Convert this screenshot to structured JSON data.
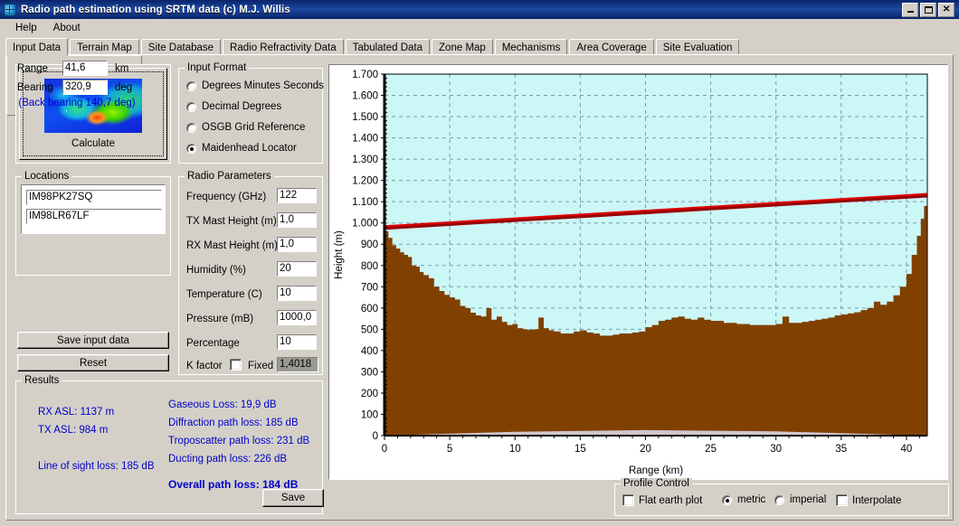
{
  "window": {
    "title": "Radio path estimation using SRTM data (c) M.J. Willis",
    "icon": "globe-icon",
    "minimize": "_",
    "maximize": "□",
    "close": "✕"
  },
  "menu": {
    "items": [
      "Help",
      "About"
    ]
  },
  "tabs": [
    {
      "label": "Input Data",
      "active": true
    },
    {
      "label": "Terrain Map",
      "active": false
    },
    {
      "label": "Site Database",
      "active": false
    },
    {
      "label": "Radio Refractivity Data",
      "active": false
    },
    {
      "label": "Tabulated Data",
      "active": false
    },
    {
      "label": "Zone Map",
      "active": false
    },
    {
      "label": "Mechanisms",
      "active": false
    },
    {
      "label": "Area Coverage",
      "active": false
    },
    {
      "label": "Site Evaluation",
      "active": false
    }
  ],
  "calculate": {
    "label": "Calculate",
    "image": "europe-terrain-map-thumbnail"
  },
  "input_format": {
    "title": "Input Format",
    "options": [
      {
        "label": "Degrees Minutes Seconds",
        "selected": false
      },
      {
        "label": "Decimal Degrees",
        "selected": false
      },
      {
        "label": "OSGB Grid Reference",
        "selected": false
      },
      {
        "label": "Maidenhead Locator",
        "selected": true
      }
    ]
  },
  "locations": {
    "title": "Locations",
    "location1": "IM98PK27SQ",
    "location2": "IM98LR67LF",
    "range_label": "Range",
    "range_value": "41,6",
    "range_unit": "km",
    "bearing_label": "Bearing",
    "bearing_value": "320,9",
    "bearing_unit": "deg",
    "back_bearing": "(Back bearing 140,7 deg)"
  },
  "buttons": {
    "save_input": "Save input data",
    "reset": "Reset",
    "save_results": "Save"
  },
  "radio_parameters": {
    "title": "Radio Parameters",
    "rows": [
      {
        "label": "Frequency (GHz)",
        "value": "122"
      },
      {
        "label": "TX Mast Height (m)",
        "value": "1,0"
      },
      {
        "label": "RX Mast Height (m)",
        "value": "1,0"
      },
      {
        "label": "Humidity (%)",
        "value": "20"
      },
      {
        "label": "Temperature (C)",
        "value": "10"
      },
      {
        "label": "Pressure (mB)",
        "value": "1000,0"
      },
      {
        "label": "Percentage",
        "value": "10"
      }
    ],
    "k_factor_label": "K factor",
    "k_factor_fixed_label": "Fixed",
    "k_factor_fixed_checked": false,
    "k_factor_value": "1,4018"
  },
  "results": {
    "title": "Results",
    "left": [
      "RX ASL: 1137 m",
      "TX ASL: 984 m",
      "Line of sight loss: 185 dB"
    ],
    "right": [
      "Gaseous Loss: 19,9 dB",
      "Diffraction path loss: 185 dB",
      "Troposcatter path loss: 231 dB",
      "Ducting path loss: 226 dB"
    ],
    "overall": "Overall path loss: 184 dB"
  },
  "profile_control": {
    "title": "Profile Control",
    "flat_earth_label": "Flat earth plot",
    "flat_earth_checked": false,
    "metric_label": "metric",
    "metric_selected": true,
    "imperial_label": "imperial",
    "imperial_selected": false,
    "interpolate_label": "Interpolate",
    "interpolate_checked": false
  },
  "colors": {
    "titlebar": "#0a246a",
    "face": "#d4d0c8",
    "sky": "#ccf7f7",
    "terrain": "#804000",
    "los_line": "#e00000",
    "los_line_dark": "#990000",
    "result_text": "#0000cc",
    "grid": "#7a9aa8",
    "curvature_band": "#cfc6cf"
  },
  "chart_data": {
    "type": "area",
    "title": "",
    "xlabel": "Range (km)",
    "ylabel": "Height (m)",
    "xlim": [
      0,
      41.6
    ],
    "ylim": [
      0,
      1700
    ],
    "xticks": [
      0,
      5,
      10,
      15,
      20,
      25,
      30,
      35,
      40
    ],
    "yticks": [
      0,
      100,
      200,
      300,
      400,
      500,
      600,
      700,
      800,
      900,
      1000,
      1100,
      1200,
      1300,
      1400,
      1500,
      1600,
      1700
    ],
    "ytick_labels": [
      "0",
      "100",
      "200",
      "300",
      "400",
      "500",
      "600",
      "700",
      "800",
      "900",
      "1.000",
      "1.100",
      "1.200",
      "1.300",
      "1.400",
      "1.500",
      "1.600",
      "1.700"
    ],
    "grid": true,
    "legend": "none",
    "series": [
      {
        "name": "Terrain profile",
        "type": "area",
        "fill": "#804000",
        "x": [
          0.0,
          0.3,
          0.6,
          0.9,
          1.2,
          1.5,
          1.8,
          2.1,
          2.4,
          2.7,
          3.0,
          3.4,
          3.8,
          4.2,
          4.6,
          5.0,
          5.4,
          5.8,
          6.2,
          6.6,
          7.0,
          7.4,
          7.8,
          8.2,
          8.6,
          9.0,
          9.4,
          9.8,
          10.2,
          10.6,
          11.0,
          11.4,
          11.8,
          12.2,
          12.6,
          13.0,
          13.5,
          14.0,
          14.5,
          15.0,
          15.5,
          16.0,
          16.5,
          17.0,
          17.5,
          18.0,
          18.5,
          19.0,
          19.5,
          20.0,
          20.5,
          21.0,
          21.5,
          22.0,
          22.5,
          23.0,
          23.5,
          24.0,
          24.5,
          25.0,
          25.5,
          26.0,
          26.5,
          27.0,
          27.5,
          28.0,
          28.5,
          29.0,
          29.5,
          30.0,
          30.5,
          31.0,
          31.5,
          32.0,
          32.5,
          33.0,
          33.5,
          34.0,
          34.5,
          35.0,
          35.5,
          36.0,
          36.5,
          37.0,
          37.5,
          38.0,
          38.5,
          39.0,
          39.5,
          40.0,
          40.4,
          40.8,
          41.1,
          41.35,
          41.6
        ],
        "y": [
          960,
          930,
          895,
          880,
          862,
          850,
          840,
          800,
          795,
          770,
          755,
          740,
          700,
          680,
          662,
          650,
          640,
          610,
          600,
          578,
          565,
          560,
          600,
          545,
          560,
          535,
          520,
          525,
          505,
          500,
          498,
          500,
          555,
          505,
          495,
          490,
          480,
          480,
          490,
          495,
          485,
          480,
          470,
          470,
          475,
          480,
          480,
          485,
          490,
          510,
          520,
          540,
          545,
          555,
          560,
          550,
          545,
          555,
          545,
          540,
          540,
          530,
          530,
          525,
          525,
          520,
          520,
          520,
          520,
          525,
          560,
          530,
          530,
          535,
          540,
          545,
          550,
          555,
          565,
          570,
          575,
          580,
          590,
          600,
          630,
          615,
          630,
          660,
          700,
          760,
          850,
          940,
          1020,
          1080,
          1137
        ]
      },
      {
        "name": "Line of sight path",
        "type": "line",
        "color": "#e00000",
        "x": [
          0,
          41.6
        ],
        "y": [
          985,
          1137
        ]
      },
      {
        "name": "Earth curvature band",
        "type": "area",
        "fill": "#cfc6cf",
        "x": [
          0,
          10,
          20,
          30,
          41.6
        ],
        "y": [
          0,
          18,
          26,
          20,
          0
        ]
      }
    ],
    "annotations": [
      {
        "text": "TX ASL: 984 m",
        "at_x": 0
      },
      {
        "text": "RX ASL: 1137 m",
        "at_x": 41.6
      }
    ]
  }
}
